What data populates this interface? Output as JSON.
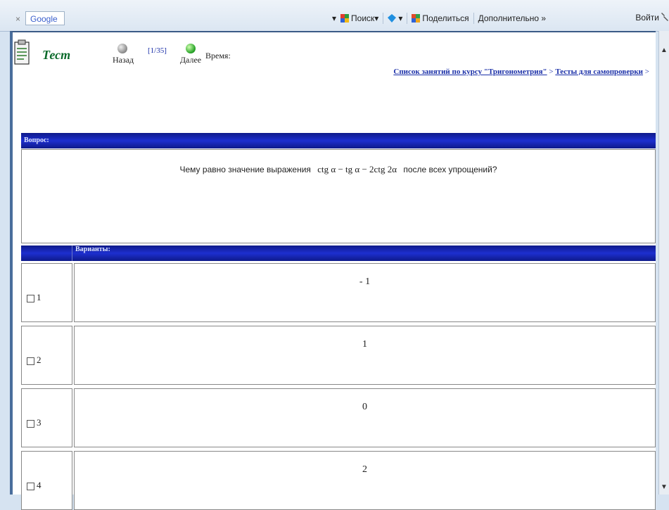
{
  "toolbar": {
    "close": "×",
    "search_value": "Google",
    "search_button": "Поиск",
    "share_button": "Поделиться",
    "more_button": "Дополнительно »",
    "signin_button": "Войти"
  },
  "header": {
    "title": "Тест",
    "back_label": "Назад",
    "counter": "[1/35]",
    "next_label": "Далее",
    "time_label": "Время:",
    "breadcrumb": [
      "Список занятий по курсу \"Тригонометрия\"",
      ">",
      "Тесты для самопроверки",
      ">"
    ]
  },
  "question": {
    "header": "Вопрос:",
    "text_before": "Чему равно значение выражения",
    "formula": "ctg α − tg α − 2ctg 2α",
    "text_after": "после всех упрощений?"
  },
  "variants": {
    "header": "Варианты:",
    "options": [
      {
        "num": "1",
        "value": "- 1"
      },
      {
        "num": "2",
        "value": "1"
      },
      {
        "num": "3",
        "value": "0"
      },
      {
        "num": "4",
        "value": "2"
      }
    ]
  },
  "colors": {
    "bar_blue": "#1d2fcf",
    "link_blue": "#1a2fa8",
    "title_green": "#0a6a2a"
  }
}
